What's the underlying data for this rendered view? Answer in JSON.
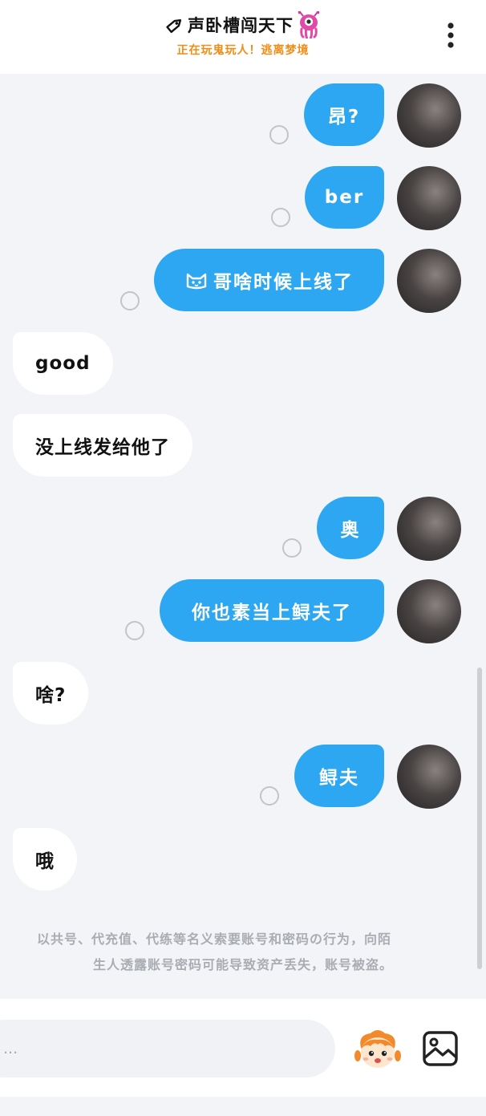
{
  "header": {
    "title": "声卧槽闯天下",
    "subtitle": "正在玩鬼玩人！逃离梦境"
  },
  "messages": [
    {
      "direction": "out",
      "text": "昂?"
    },
    {
      "direction": "out",
      "text": "ber"
    },
    {
      "direction": "out",
      "text": "哥啥时候上线了",
      "icon": "cat-face-icon"
    },
    {
      "direction": "in",
      "text": "good"
    },
    {
      "direction": "in",
      "text": "没上线发给他了"
    },
    {
      "direction": "out",
      "text": "奥"
    },
    {
      "direction": "out",
      "text": "你也素当上鲟夫了"
    },
    {
      "direction": "in",
      "text": "啥?"
    },
    {
      "direction": "out",
      "text": "鲟夫"
    },
    {
      "direction": "in",
      "text": "哦"
    }
  ],
  "notice": {
    "line1": "以共号、代充值、代练等名义索要账号和密码の行为，向陌",
    "line2": "生人透露账号密码可能导致资产丢失，账号被盗。"
  },
  "input": {
    "placeholder": "..."
  },
  "icons": {
    "title_left": "tag-icon",
    "title_right": "pink-octopus-icon",
    "menu": "more-vertical-icon",
    "mascot": "mascot-icon",
    "image": "image-icon"
  },
  "colors": {
    "outgoing_bubble": "#2ea7f2",
    "incoming_bubble": "#ffffff",
    "subtitle": "#f28c18",
    "background": "#f3f4f7"
  }
}
